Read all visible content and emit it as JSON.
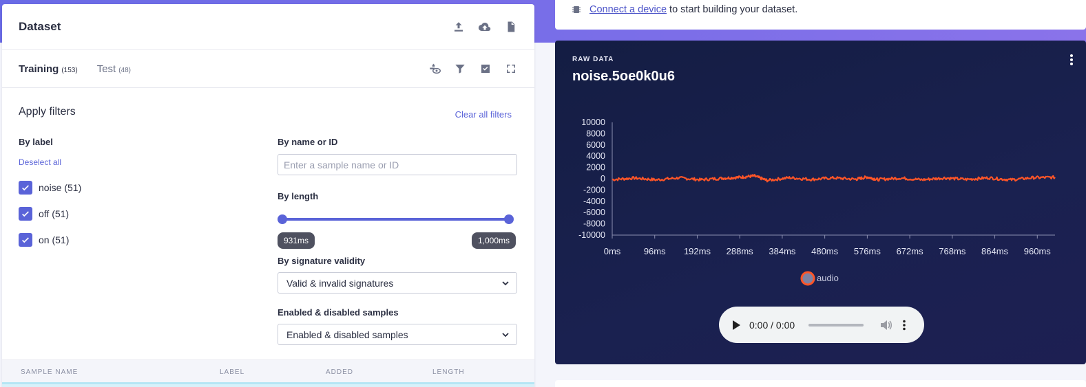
{
  "dataset": {
    "title": "Dataset",
    "header_icons": [
      "upload-icon",
      "cloud-upload-icon",
      "download-file-icon"
    ],
    "tabs": [
      {
        "label": "Training",
        "count": "(153)",
        "active": true
      },
      {
        "label": "Test",
        "count": "(48)",
        "active": false
      }
    ],
    "tool_icons": [
      "settings-eye-icon",
      "filter-icon",
      "select-checkbox-icon",
      "expand-icon"
    ]
  },
  "filters": {
    "title": "Apply filters",
    "clear_all": "Clear all filters",
    "by_label": {
      "title": "By label",
      "deselect_all": "Deselect all",
      "items": [
        {
          "label": "noise (51)",
          "checked": true
        },
        {
          "label": "off (51)",
          "checked": true
        },
        {
          "label": "on (51)",
          "checked": true
        }
      ]
    },
    "by_name": {
      "title": "By name or ID",
      "placeholder": "Enter a sample name or ID",
      "value": ""
    },
    "by_length": {
      "title": "By length",
      "min_label": "931ms",
      "max_label": "1,000ms"
    },
    "by_signature": {
      "title": "By signature validity",
      "selected": "Valid & invalid signatures"
    },
    "enabled": {
      "title": "Enabled & disabled samples",
      "selected": "Enabled & disabled samples"
    }
  },
  "table": {
    "columns": [
      "SAMPLE NAME",
      "LABEL",
      "ADDED",
      "LENGTH"
    ]
  },
  "notice": {
    "link": "Connect a device",
    "text": "to start building your dataset."
  },
  "raw_data": {
    "section_label": "RAW DATA",
    "sample_name": "noise.5oe0k0u6",
    "legend": "audio",
    "series_color": "#ff5528",
    "audio_player": {
      "time": "0:00 / 0:00"
    }
  },
  "chart_data": {
    "type": "line",
    "title": "",
    "xlabel": "",
    "ylabel": "",
    "y_ticks": [
      "10000",
      "8000",
      "6000",
      "4000",
      "2000",
      "0",
      "-2000",
      "-4000",
      "-6000",
      "-8000",
      "-10000"
    ],
    "x_ticks": [
      "0ms",
      "96ms",
      "192ms",
      "288ms",
      "384ms",
      "480ms",
      "576ms",
      "672ms",
      "768ms",
      "864ms",
      "960ms"
    ],
    "ylim": [
      -10000,
      10000
    ],
    "xlim": [
      0,
      1000
    ],
    "grid": false,
    "legend_position": "bottom-center",
    "series": [
      {
        "name": "audio",
        "color": "#ff5528",
        "x": [
          0,
          50,
          100,
          150,
          200,
          250,
          288,
          320,
          350,
          400,
          450,
          500,
          550,
          576,
          600,
          650,
          700,
          750,
          800,
          850,
          900,
          950,
          1000
        ],
        "values": [
          -150,
          120,
          -200,
          150,
          -180,
          90,
          250,
          500,
          -300,
          180,
          -120,
          150,
          -100,
          300,
          -150,
          120,
          -180,
          140,
          -120,
          160,
          -200,
          180,
          250
        ]
      }
    ]
  }
}
